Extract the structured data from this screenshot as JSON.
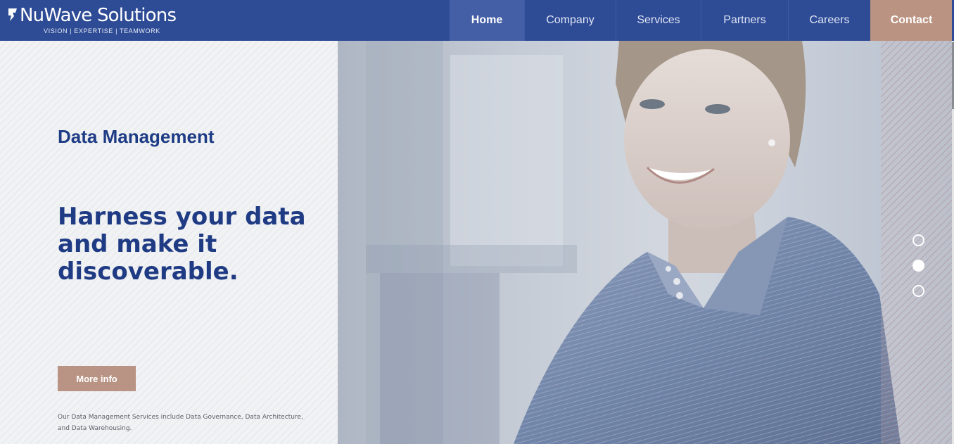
{
  "brand": {
    "name": "NuWave Solutions",
    "tagline": "VISION | EXPERTISE | TEAMWORK"
  },
  "nav": {
    "items": [
      {
        "label": "Home",
        "active": true
      },
      {
        "label": "Company"
      },
      {
        "label": "Services"
      },
      {
        "label": "Partners"
      },
      {
        "label": "Careers"
      },
      {
        "label": "Contact"
      }
    ]
  },
  "hero": {
    "kicker": "Data Management",
    "headline": "Harness your data and make it discoverable.",
    "cta_label": "More info",
    "description": "Our Data Management Services include Data Governance, Data Architecture, and Data Warehousing.",
    "slides": {
      "count": 3,
      "active_index": 1
    }
  },
  "colors": {
    "nav_bg": "#2e4b96",
    "accent": "#bb9382",
    "heading": "#1e3c85"
  }
}
